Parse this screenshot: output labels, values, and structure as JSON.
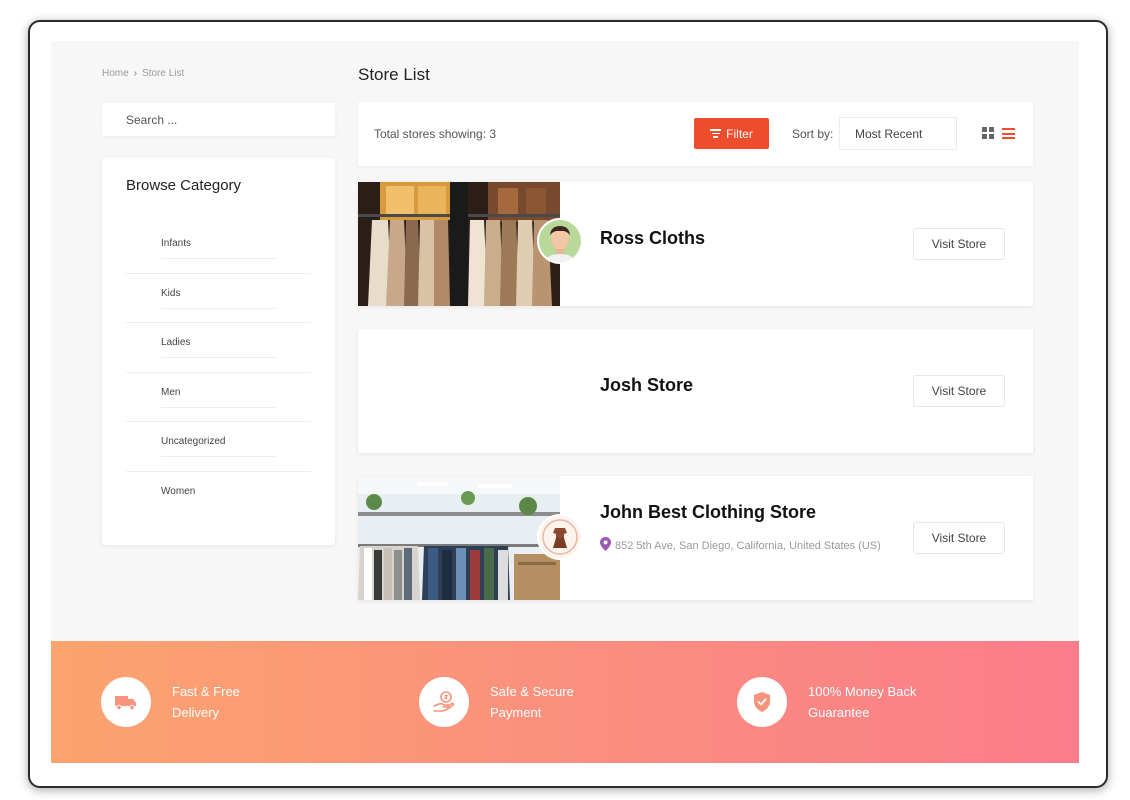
{
  "breadcrumb": {
    "home": "Home",
    "separator": "›",
    "current": "Store List"
  },
  "sidebar": {
    "search_placeholder": "Search ...",
    "category_title": "Browse Category",
    "categories": [
      {
        "label": "Infants"
      },
      {
        "label": "Kids"
      },
      {
        "label": "Ladies"
      },
      {
        "label": "Men"
      },
      {
        "label": "Uncategorized"
      },
      {
        "label": "Women"
      }
    ]
  },
  "main": {
    "title": "Store List",
    "toolbar": {
      "total_label": "Total stores showing: 3",
      "filter_label": "Filter",
      "sort_label": "Sort by:",
      "sort_value": "Most Recent"
    },
    "stores": [
      {
        "name": "Ross Cloths",
        "address": "",
        "button_label": "Visit Store"
      },
      {
        "name": "Josh Store",
        "address": "",
        "button_label": "Visit Store"
      },
      {
        "name": "John Best Clothing Store",
        "address": "852 5th Ave, San Diego, California, United States (US)",
        "button_label": "Visit Store"
      }
    ]
  },
  "footer": {
    "features": [
      {
        "icon": "truck-icon",
        "line1": "Fast & Free",
        "line2": "Delivery"
      },
      {
        "icon": "payment-hand-icon",
        "line1": "Safe & Secure",
        "line2": "Payment"
      },
      {
        "icon": "shield-icon",
        "line1": "100% Money Back",
        "line2": "Guarantee"
      }
    ]
  },
  "colors": {
    "accent": "#ee4d2d",
    "pin": "#9b59b6",
    "footer_start": "#fba46e",
    "footer_end": "#fb7c8b",
    "page_bg": "#f7f7f7"
  }
}
